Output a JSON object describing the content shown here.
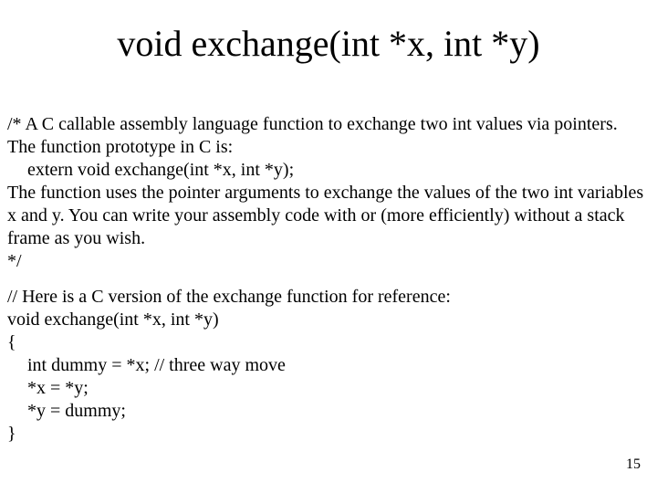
{
  "title": "void exchange(int *x, int *y)",
  "comment": {
    "line1": "/* A C callable assembly language function to exchange two int values via pointers.",
    "line2": "The function prototype in C is:",
    "line3": "extern void exchange(int *x, int *y);",
    "line4": "The function uses the pointer arguments to exchange the values of the two int variables x and y.  You can write your assembly code with or (more efficiently) without a stack frame as you wish.",
    "line5": "*/"
  },
  "code": {
    "line1": "// Here is a C version of the exchange function for reference:",
    "line2": "void exchange(int *x, int *y)",
    "line3": "{",
    "line4": "int dummy = *x;    // three way move",
    "line5": "*x = *y;",
    "line6": "*y = dummy;",
    "line7": "}"
  },
  "page_number": "15"
}
